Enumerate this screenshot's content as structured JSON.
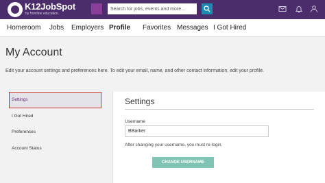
{
  "header": {
    "logo_text": "K12JobSpot",
    "logo_sub": "by frontline education.",
    "search_placeholder": "Search for jobs, events and more..."
  },
  "nav": {
    "items": [
      "Homeroom",
      "Jobs",
      "Employers",
      "Profile",
      "Favorites",
      "Messages",
      "I Got Hired"
    ]
  },
  "page": {
    "title": "My Account",
    "description": "Edit your account settings and preferences here. To edit your email, name, and other contact information, edit your profile."
  },
  "sidebar": {
    "items": [
      "Settings",
      "I Got Hired",
      "Preferences",
      "Account Status"
    ]
  },
  "settings": {
    "title": "Settings",
    "username_label": "Username",
    "username_value": "BBarker",
    "help_text": "After changing your username, you must re-login.",
    "change_button": "CHANGE USERNAME"
  },
  "colors": {
    "brand": "#4b2d6b",
    "search_button": "#1e8ab0",
    "primary_button": "#7fc4b4",
    "highlight_border": "#c9302c"
  }
}
